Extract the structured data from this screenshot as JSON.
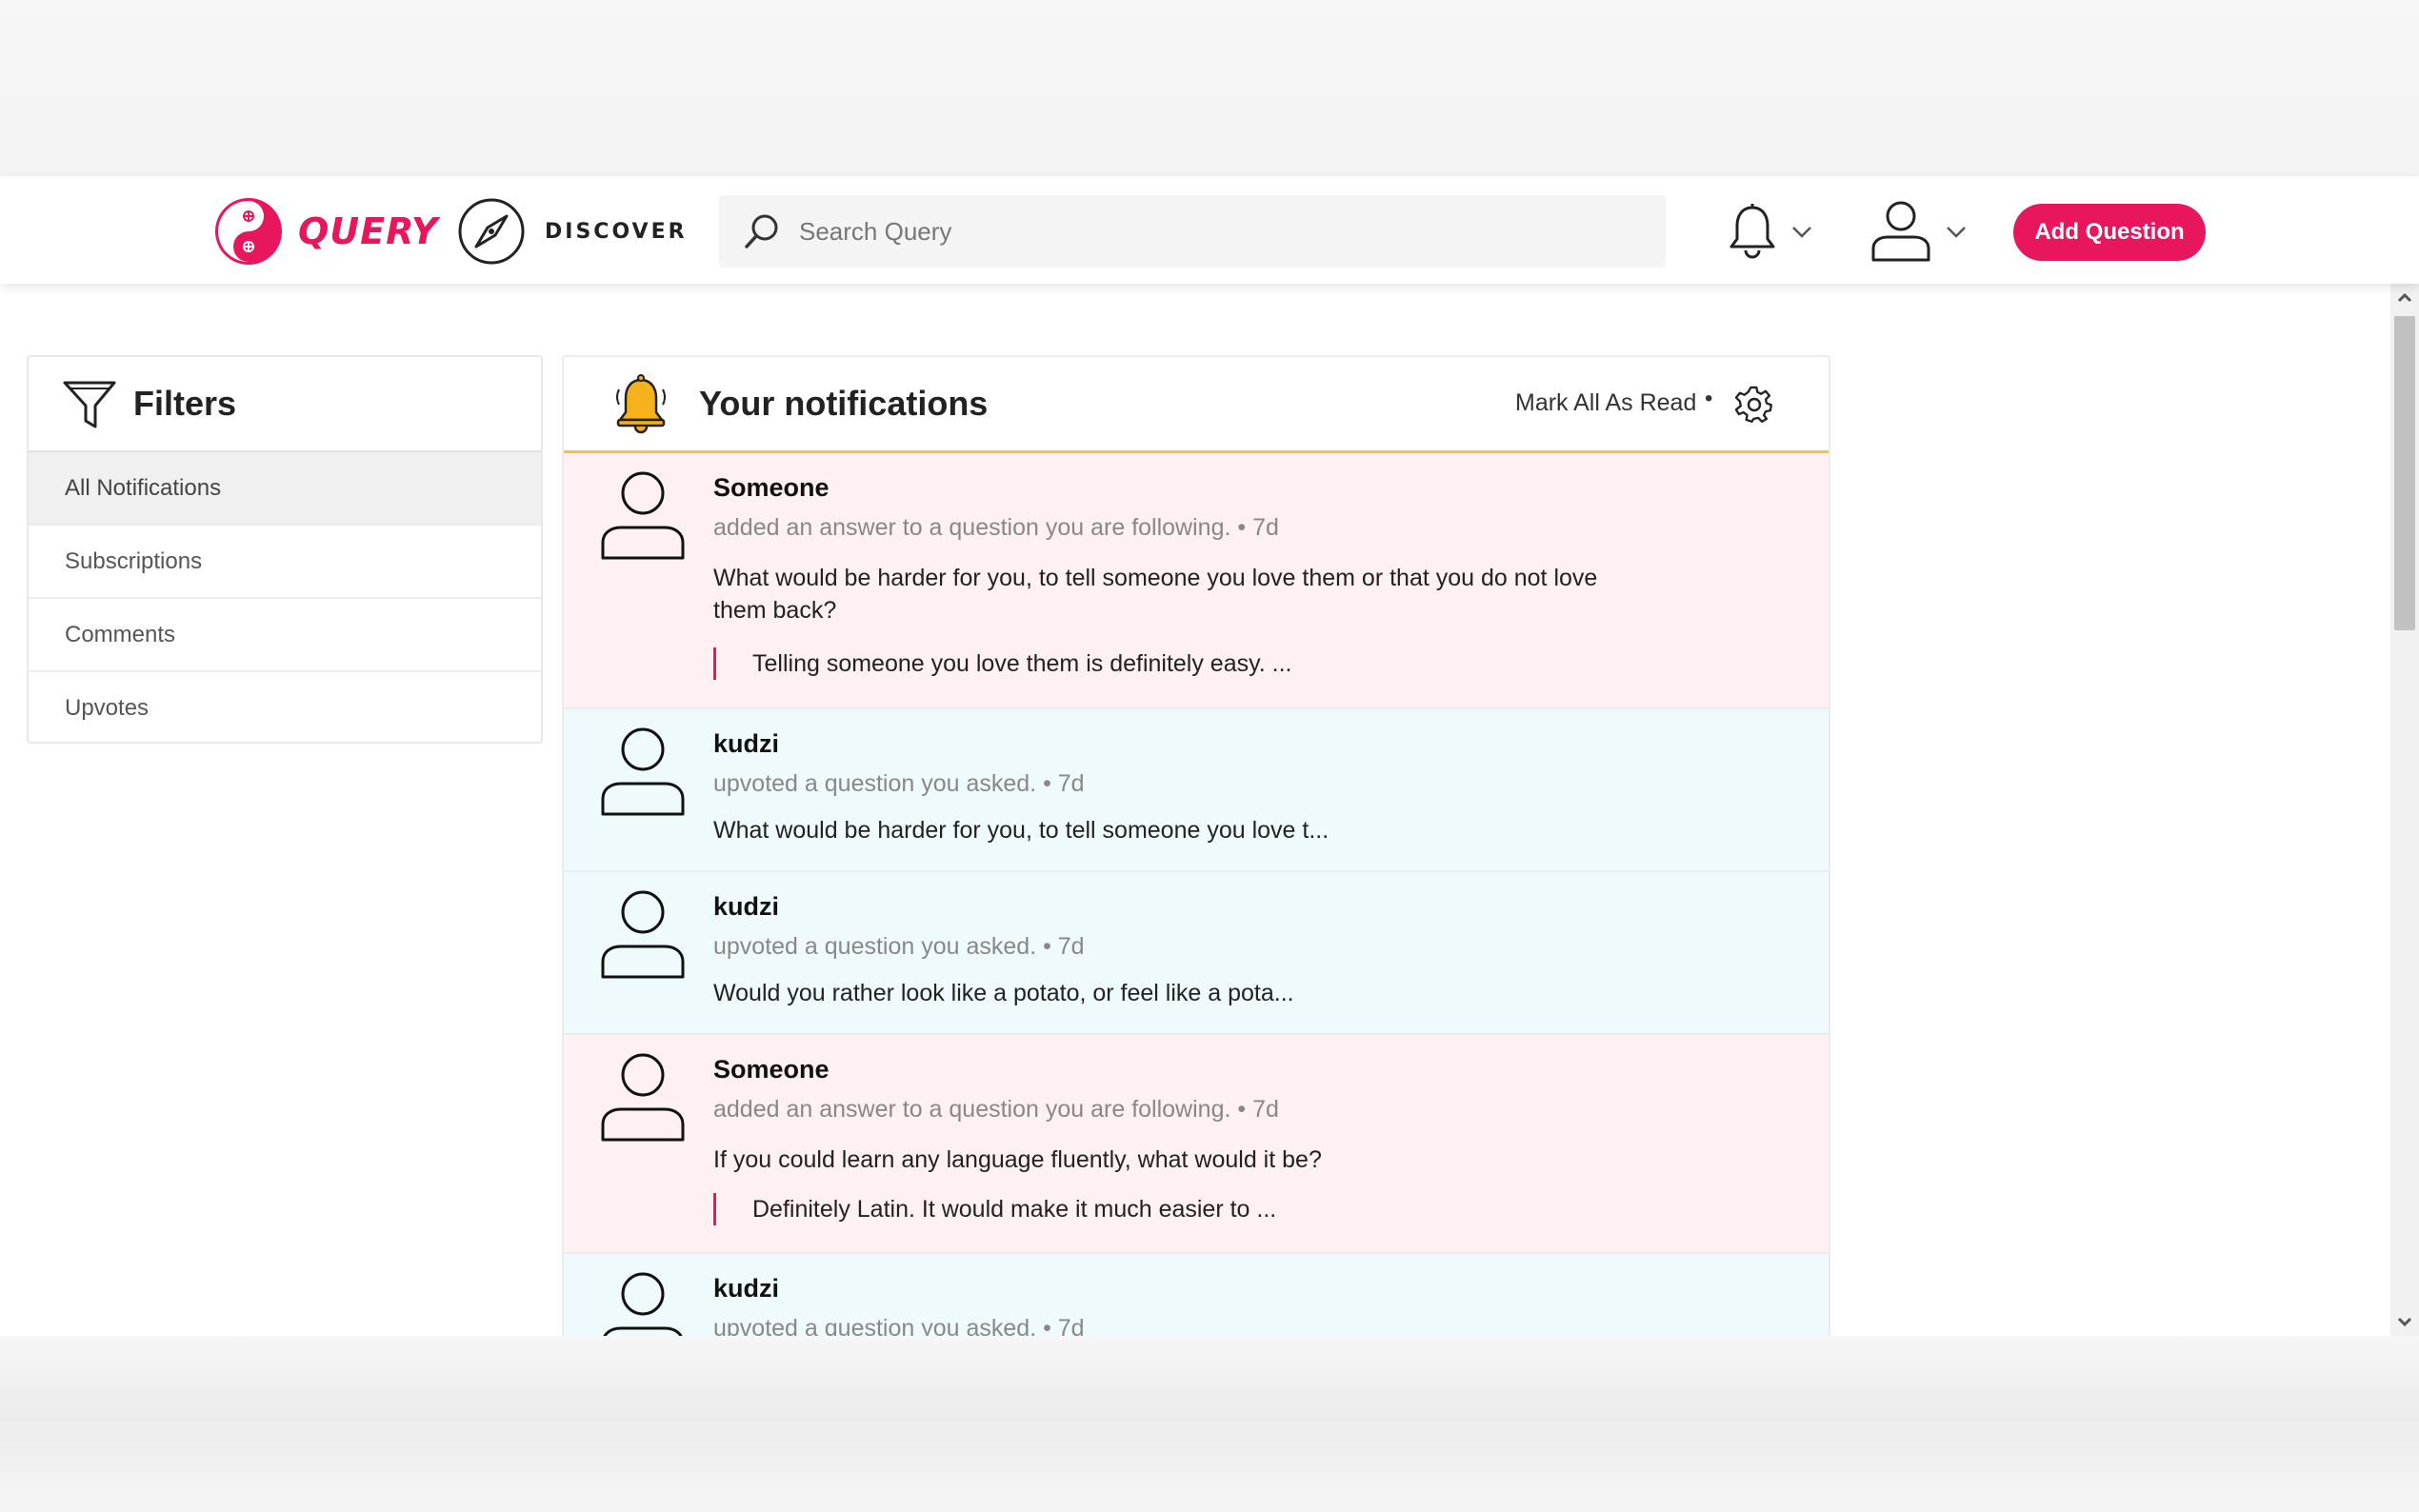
{
  "header": {
    "logo_text": "QUERY",
    "discover_label": "DISCOVER",
    "search_placeholder": "Search Query",
    "add_question_label": "Add Question",
    "brand_color": "#e8175d"
  },
  "filters": {
    "title": "Filters",
    "items": [
      {
        "label": "All Notifications",
        "active": true
      },
      {
        "label": "Subscriptions",
        "active": false
      },
      {
        "label": "Comments",
        "active": false
      },
      {
        "label": "Upvotes",
        "active": false
      }
    ]
  },
  "notifications": {
    "title": "Your notifications",
    "mark_all_label": "Mark All As Read",
    "separator": "•",
    "items": [
      {
        "name": "Someone",
        "action": "added an answer to a question you are following. • 7d",
        "question": "What would be harder for you, to tell someone you love them or that you do not love them back?",
        "quote": "Telling someone you love them is definitely easy. ...",
        "tone": "pink"
      },
      {
        "name": "kudzi",
        "action": "upvoted a question you asked. • 7d",
        "question": "What would be harder for you, to tell someone you love t...",
        "tone": "blue"
      },
      {
        "name": "kudzi",
        "action": "upvoted a question you asked. • 7d",
        "question": "Would you rather look like a potato, or feel like a pota...",
        "tone": "blue"
      },
      {
        "name": "Someone",
        "action": "added an answer to a question you are following. • 7d",
        "question": "If you could learn any language fluently, what would it be?",
        "quote": "Definitely Latin. It would make it much easier to ...",
        "tone": "pink"
      },
      {
        "name": "kudzi",
        "action": "upvoted a question you asked. • 7d",
        "tone": "blue"
      }
    ]
  }
}
